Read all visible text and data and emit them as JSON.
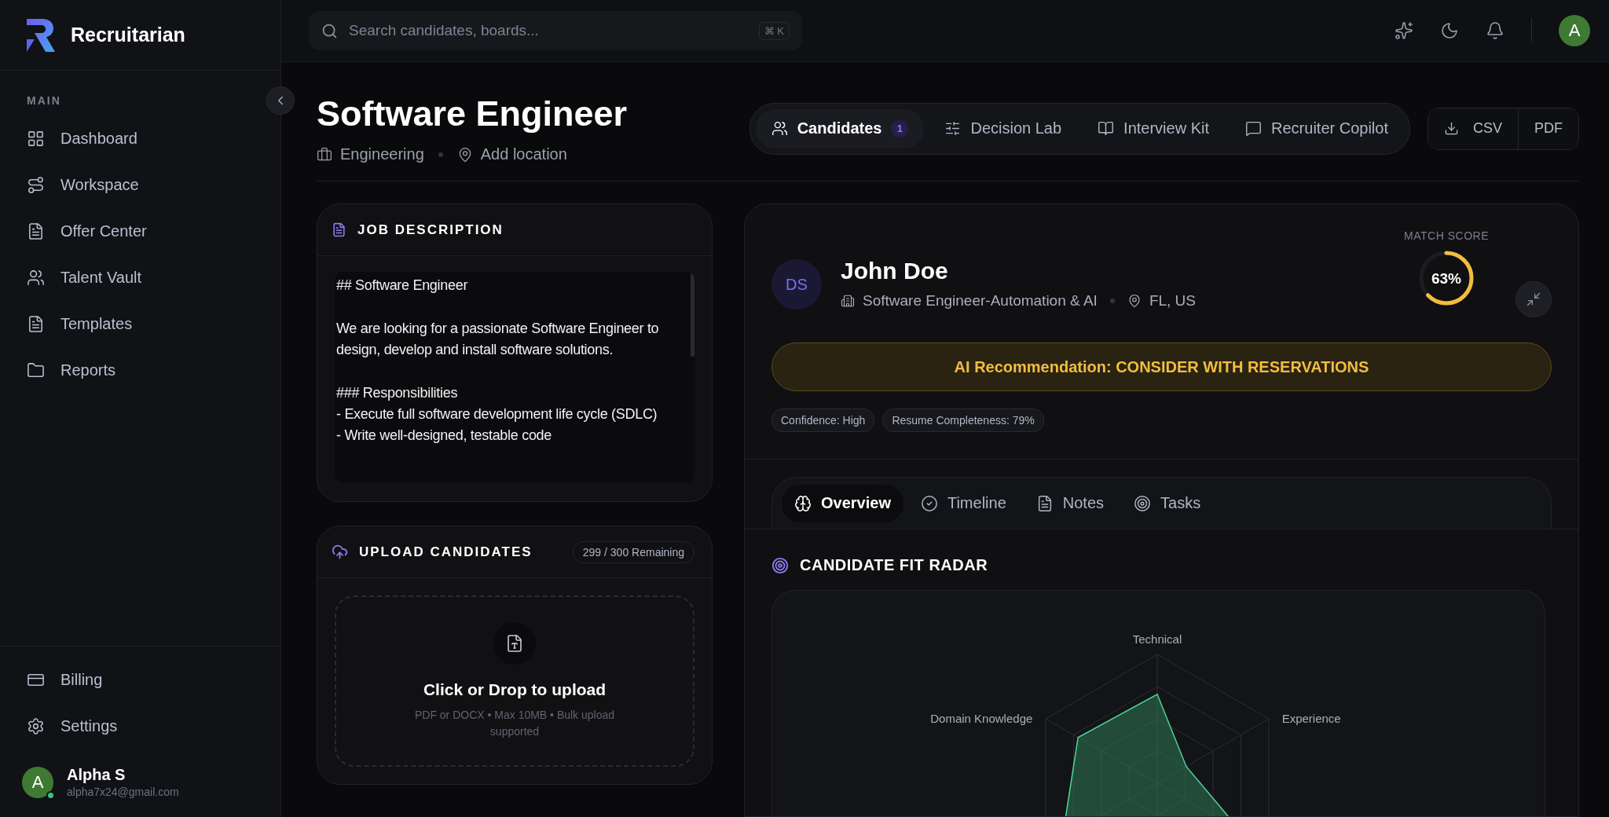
{
  "app": {
    "name": "Recruitarian"
  },
  "search": {
    "placeholder": "Search candidates, boards...",
    "shortcut": "⌘ K"
  },
  "sidebar": {
    "section": "MAIN",
    "items": [
      {
        "kind": "dashboard",
        "label": "Dashboard",
        "selected": false
      },
      {
        "kind": "workspace",
        "label": "Workspace",
        "selected": false
      },
      {
        "kind": "offer",
        "label": "Offer Center",
        "selected": false
      },
      {
        "kind": "talent",
        "label": "Talent Vault",
        "selected": false
      },
      {
        "kind": "templates",
        "label": "Templates",
        "selected": false
      },
      {
        "kind": "reports",
        "label": "Reports",
        "selected": false
      }
    ],
    "bottom_items": [
      {
        "kind": "billing",
        "label": "Billing",
        "selected": false
      },
      {
        "kind": "settings",
        "label": "Settings",
        "selected": false
      }
    ],
    "user": {
      "initial": "A",
      "name": "Alpha S",
      "email": "alpha7x24@gmail.com",
      "online": true
    }
  },
  "topbar": {
    "avatar_initial": "A"
  },
  "job": {
    "title": "Software Engineer",
    "department": "Engineering",
    "location": "Add location"
  },
  "tabs": [
    {
      "kind": "candidates",
      "label": "Candidates",
      "count": "1",
      "selected": true
    },
    {
      "kind": "decision",
      "label": "Decision Lab",
      "selected": false
    },
    {
      "kind": "interview",
      "label": "Interview Kit",
      "selected": false
    },
    {
      "kind": "copilot",
      "label": "Recruiter Copilot",
      "selected": false
    }
  ],
  "export": [
    {
      "kind": "csv",
      "label": "CSV"
    },
    {
      "kind": "pdf",
      "label": "PDF"
    }
  ],
  "job_description": {
    "title": "JOB DESCRIPTION",
    "paragraphs": [
      [
        "## Software Engineer"
      ],
      [
        "We are looking for a passionate Software Engineer to design, develop and install software solutions."
      ],
      [
        "### Responsibilities",
        "- Execute full software development life cycle (SDLC)",
        "- Write well-designed, testable code"
      ]
    ]
  },
  "upload": {
    "title": "UPLOAD CANDIDATES",
    "remaining": "299 / 300 Remaining",
    "headline": "Click or Drop to upload",
    "hint": "PDF or DOCX • Max 10MB • Bulk upload supported"
  },
  "candidate": {
    "initials": "DS",
    "name": "John Doe",
    "role": "Software Engineer-Automation & AI",
    "location": "FL, US",
    "match_label": "MATCH SCORE",
    "match_score": "63%",
    "level": 0.63,
    "recommendation": "AI Recommendation: CONSIDER WITH RESERVATIONS",
    "badges": [
      "Confidence: High",
      "Resume Completeness: 79%"
    ]
  },
  "detail_tabs": [
    {
      "kind": "overview",
      "label": "Overview",
      "selected": true
    },
    {
      "kind": "timeline",
      "label": "Timeline",
      "selected": false
    },
    {
      "kind": "notes",
      "label": "Notes",
      "selected": false
    },
    {
      "kind": "tasks",
      "label": "Tasks",
      "selected": false
    }
  ],
  "radar": {
    "title": "CANDIDATE FIT RADAR",
    "axes": [
      "Technical",
      "Experience",
      "Domain Knowledge"
    ]
  }
}
